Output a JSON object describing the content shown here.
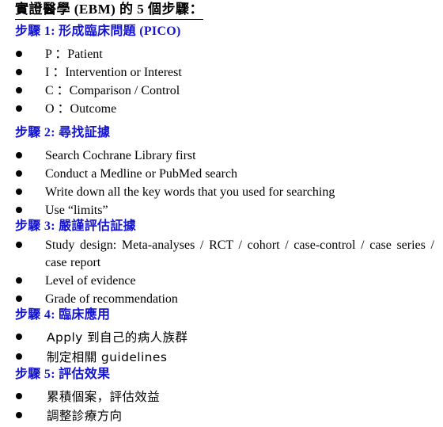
{
  "document": {
    "title": "實證醫學 (EBM) 的 5 個步驟：",
    "title_color": "#000000",
    "heading_color": "#1414d2",
    "background_color": "#ffffff",
    "bullet_glyph": "●"
  },
  "steps": [
    {
      "heading": "步驟 1: 形成臨床問題 (PICO)",
      "items": [
        "P ：Patient",
        "I ：Intervention or Interest",
        "C ：Comparison / Control",
        "O ：Outcome"
      ]
    },
    {
      "heading": "步驟 2: 尋找証據",
      "items": [
        "Search Cochrane Library first",
        "Conduct a Medline or PubMed search",
        "Write down all the key words that you used for searching",
        "Use “limits”"
      ]
    },
    {
      "heading": "步驟 3: 嚴謹評估証據",
      "items": [
        "Study  design: Meta-analyses / RCT / cohort / case-control / case series / case report",
        "Level of evidence",
        "Grade of recommendation"
      ]
    },
    {
      "heading": "步驟 4: 臨床應用",
      "items": [
        "Apply  到自己的病人族群",
        "制定相關  guidelines"
      ]
    },
    {
      "heading": "步驟 5: 評估效果",
      "items": [
        "累積個案，評估效益",
        "調整診療方向"
      ]
    }
  ]
}
